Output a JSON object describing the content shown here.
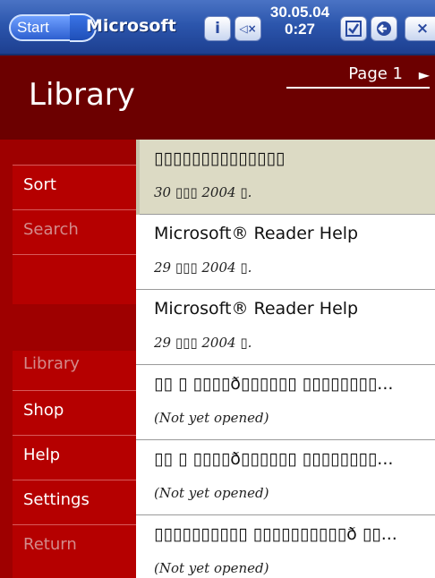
{
  "taskbar": {
    "start_label": "Start",
    "app_title": "Microsoft",
    "info_label": "i",
    "mute_label": "◁×",
    "date": "30.05.04",
    "time": "0:27",
    "checklist_icon": "checklist-icon",
    "back_icon": "back-arrow-icon",
    "close_label": "×"
  },
  "header": {
    "title": "Library",
    "page_label": "Page 1",
    "page_arrow": "►"
  },
  "sidebar": {
    "items": [
      {
        "label": "Sort",
        "enabled": true
      },
      {
        "label": "Search",
        "enabled": false
      },
      {
        "label": "Library",
        "enabled": false
      },
      {
        "label": "Shop",
        "enabled": true
      },
      {
        "label": "Help",
        "enabled": true
      },
      {
        "label": "Settings",
        "enabled": true
      },
      {
        "label": "Return",
        "enabled": false
      }
    ]
  },
  "books": [
    {
      "title": "▯▯▯▯▯▯▯▯▯▯▯▯▯▯",
      "subtitle": "30 ▯▯▯ 2004 ▯.",
      "selected": true
    },
    {
      "title": "Microsoft® Reader Help",
      "subtitle": "29 ▯▯▯ 2004 ▯.",
      "selected": false
    },
    {
      "title": "Microsoft® Reader Help",
      "subtitle": "29 ▯▯▯ 2004 ▯.",
      "selected": false
    },
    {
      "title": "▯▯ ▯ ▯▯▯▯ð▯▯▯▯▯▯ ▯▯▯▯▯▯▯▯...",
      "subtitle": "(Not yet opened)",
      "selected": false
    },
    {
      "title": "▯▯ ▯ ▯▯▯▯ð▯▯▯▯▯▯ ▯▯▯▯▯▯▯▯...",
      "subtitle": "(Not yet opened)",
      "selected": false
    },
    {
      "title": "▯▯▯▯▯▯▯▯▯▯ ▯▯▯▯▯▯▯▯▯▯ð ▯▯...",
      "subtitle": "(Not yet opened)",
      "selected": false
    }
  ],
  "colors": {
    "header_bg": "#6c0000",
    "sidebar_bg": "#9e0000",
    "selected_row_bg": "#dcdac4",
    "taskbar_blue": "#2c56ad"
  }
}
